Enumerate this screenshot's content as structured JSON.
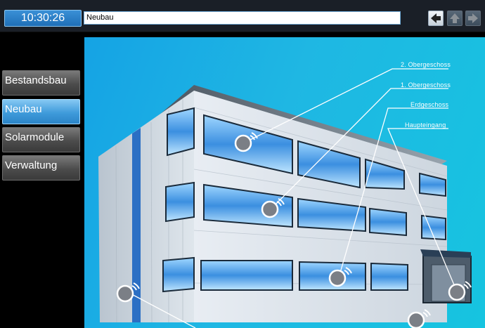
{
  "header": {
    "clock": "10:30:26",
    "breadcrumb": "Neubau"
  },
  "nav_icons": {
    "back": "back-arrow-icon",
    "up": "up-arrow-icon",
    "forward": "forward-arrow-icon"
  },
  "sidebar": {
    "items": [
      {
        "label": "Bestandsbau",
        "active": false
      },
      {
        "label": "Neubau",
        "active": true
      },
      {
        "label": "Solarmodule",
        "active": false
      },
      {
        "label": "Verwaltung",
        "active": false
      }
    ]
  },
  "building": {
    "labels": {
      "floor2": "2. Obergeschoss",
      "floor1": "1. Obergeschoss",
      "ground": "Erdgeschoss",
      "entrance": "Haupteingang"
    },
    "hotspot_icon": "wireless-sensor-icon"
  },
  "colors": {
    "accent": "#1f6fb7",
    "active_menu": "#3f9bdb",
    "background": "#16b4e3"
  }
}
